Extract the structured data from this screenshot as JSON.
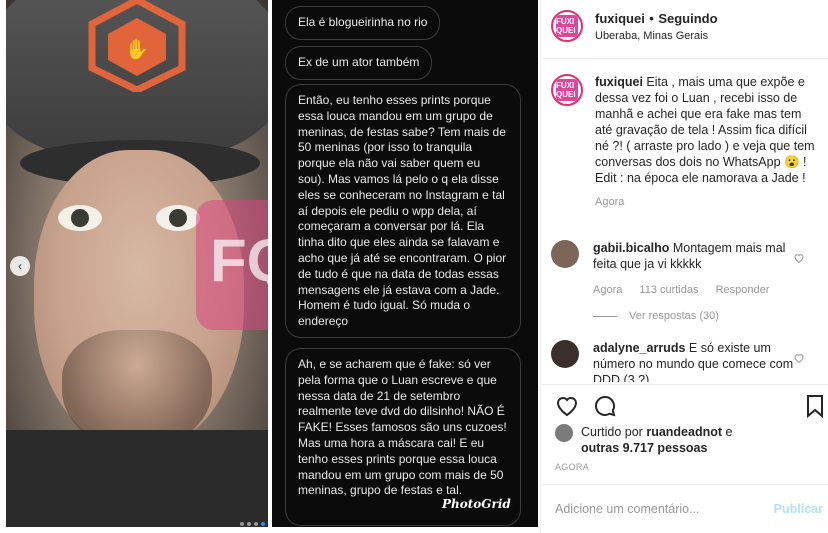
{
  "post": {
    "username": "fuxiquei",
    "separator": "•",
    "follow_state": "Seguindo",
    "location": "Uberaba, Minas Gerais",
    "avatar_logo": "FUXI QUEI",
    "caption_user": "fuxiquei",
    "caption_text": "Eita , mais uma que expõe e dessa vez foi o Luan , recebi isso de manhã e achei que era fake mas tem até gravação de tela ! Assim fica difícil né ?! ( arraste pro lado ) e veja que tem conversas dos dois no WhatsApp 😮 !",
    "caption_edit": "Edit : na época ele namorava a Jade !",
    "caption_time": "Agora"
  },
  "comments": [
    {
      "user": "gabii.bicalho",
      "text": "Montagem mais mal feita que ja vi kkkkk",
      "time": "Agora",
      "likes": "113 curtidas",
      "reply": "Responder",
      "view_replies": "Ver respostas (30)"
    },
    {
      "user": "adalyne_arruds",
      "text": "E só existe um número no mundo que comece com DDD (3 ?)..."
    }
  ],
  "likes": {
    "prefix": "Curtido por",
    "user": "ruandeadnot",
    "middle": "e",
    "others": "outras 9.717 pessoas"
  },
  "timestamp": "AGORA",
  "add_comment": {
    "placeholder": "Adicione um comentário...",
    "publish": "Publicar"
  },
  "media": {
    "chat_bubbles": [
      "Ela é blogueirinha no rio",
      "Ex de um ator também",
      "Então, eu tenho esses prints porque essa louca mandou em um grupo de meninas, de festas sabe? Tem mais de 50 meninas (por isso to tranquila porque ela não vai saber quem eu sou). Mas vamos lá pelo o q ela disse eles se conheceram no Instagram e tal aí depois ele pediu o wpp dela, aí começaram a conversar por lá. Ela tinha dito que eles ainda se falavam e acho que já até se encontraram. O pior de tudo é que na data de todas essas mensagens ele já estava com a Jade. Homem é tudo igual. Só muda o endereço",
      "Ah, e se acharem que é fake: só ver pela forma que o Luan escreve e que nessa data de 21 de setembro realmente teve dvd do dilsinho! NÃO É FAKE! Esses famosos são uns cuzoes! Mas uma hora a máscara cai! E eu tenho esses prints porque essa louca mandou em um grupo com mais de 50 meninas, grupo de festas e tal."
    ],
    "app_watermark": "PhotoGrid",
    "carousel_prev": "‹"
  },
  "icons": [
    "heart-icon",
    "comment-icon",
    "bookmark-icon",
    "small-heart-icon"
  ],
  "colors": {
    "accent": "#e1306c",
    "link": "#b2dffc",
    "muted": "#999999",
    "text": "#262626"
  }
}
